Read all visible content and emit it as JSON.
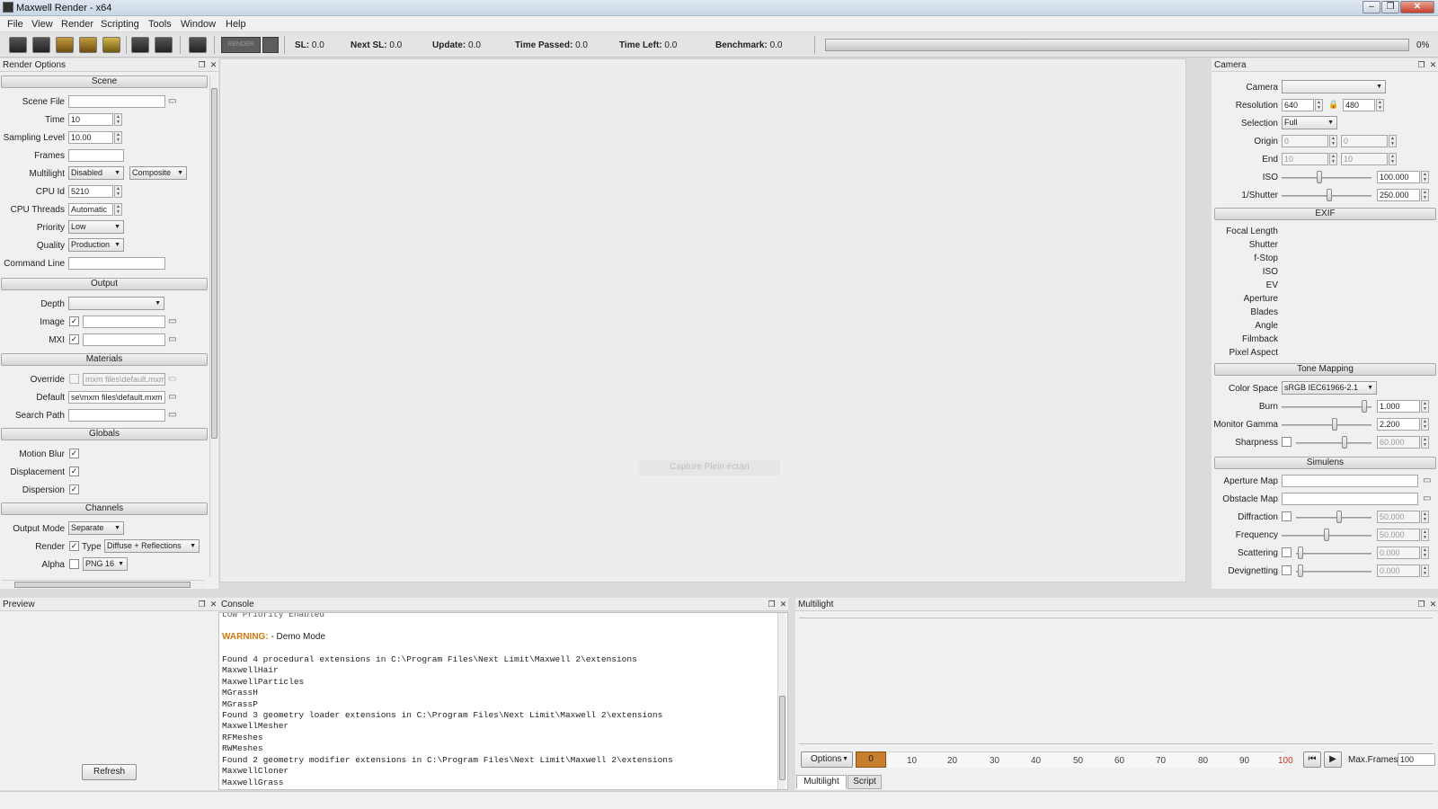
{
  "window": {
    "title": "Maxwell Render -  x64"
  },
  "menu": [
    "File",
    "View",
    "Render",
    "Scripting",
    "Tools",
    "Window",
    "Help"
  ],
  "toolbar": {
    "render_label": "RENDER"
  },
  "status": {
    "sl_label": "SL:",
    "sl_value": "0.0",
    "next_sl_label": "Next SL:",
    "next_sl_value": "0.0",
    "update_label": "Update:",
    "update_value": "0.0",
    "time_passed_label": "Time Passed:",
    "time_passed_value": "0.0",
    "time_left_label": "Time Left:",
    "time_left_value": "0.0",
    "benchmark_label": "Benchmark:",
    "benchmark_value": "0.0",
    "progress_pct": "0%",
    "progress_fraction": 0
  },
  "render_options": {
    "title": "Render Options",
    "sections": {
      "scene": "Scene",
      "output": "Output",
      "materials": "Materials",
      "globals": "Globals",
      "channels": "Channels"
    },
    "scene_file": {
      "label": "Scene File",
      "value": ""
    },
    "time": {
      "label": "Time",
      "value": "10"
    },
    "sampling": {
      "label": "Sampling Level",
      "value": "10.00"
    },
    "frames": {
      "label": "Frames",
      "value": ""
    },
    "multilight": {
      "label": "Multilight",
      "value": "Disabled",
      "mode": "Composite"
    },
    "cpu_id": {
      "label": "CPU Id",
      "value": "5210"
    },
    "cpu_threads": {
      "label": "CPU Threads",
      "value": "Automatic"
    },
    "priority": {
      "label": "Priority",
      "value": "Low"
    },
    "quality": {
      "label": "Quality",
      "value": "Production"
    },
    "command_line": {
      "label": "Command Line",
      "value": ""
    },
    "depth": {
      "label": "Depth",
      "value": ""
    },
    "image": {
      "label": "Image",
      "value": ""
    },
    "mxi": {
      "label": "MXI",
      "value": ""
    },
    "override": {
      "label": "Override",
      "value": "mxm files\\default.mxm"
    },
    "default": {
      "label": "Default",
      "value": "se\\mxm files\\default.mxm"
    },
    "search_path": {
      "label": "Search Path",
      "value": ""
    },
    "motion_blur": "Motion Blur",
    "displacement": "Displacement",
    "dispersion": "Dispersion",
    "output_mode": {
      "label": "Output Mode",
      "value": "Separate"
    },
    "render": {
      "label": "Render",
      "type_label": "Type",
      "type_value": "Diffuse + Reflections"
    },
    "alpha": {
      "label": "Alpha",
      "value": "PNG 16"
    }
  },
  "preview": {
    "title": "Preview",
    "refresh": "Refresh"
  },
  "viewport": {
    "ghost": "Capture Plein écran"
  },
  "console": {
    "title": "Console",
    "lines": [
      "Low Priority Enabled",
      "",
      "Found 4 procedural extensions in C:\\Program Files\\Next Limit\\Maxwell 2\\extensions",
      "MaxwellHair",
      "MaxwellParticles",
      "MGrassH",
      "MGrassP",
      "Found 3 geometry loader extensions in C:\\Program Files\\Next Limit\\Maxwell 2\\extensions",
      "MaxwellMesher",
      "RFMeshes",
      "RWMeshes",
      "Found 2 geometry modifier extensions in C:\\Program Files\\Next Limit\\Maxwell 2\\extensions",
      "MaxwellCloner",
      "MaxwellGrass"
    ],
    "warning_label": "WARNING:",
    "warning_text": " - Demo Mode"
  },
  "camera": {
    "title": "Camera",
    "camera": {
      "label": "Camera",
      "value": ""
    },
    "resolution": {
      "label": "Resolution",
      "w": "640",
      "h": "480"
    },
    "selection": {
      "label": "Selection",
      "value": "Full"
    },
    "origin": {
      "label": "Origin",
      "x": "0",
      "y": "0"
    },
    "end": {
      "label": "End",
      "x": "10",
      "y": "10"
    },
    "iso": {
      "label": "ISO",
      "value": "100.000",
      "slider": 0.42
    },
    "shutter": {
      "label": "1/Shutter",
      "value": "250.000",
      "slider": 0.53
    },
    "exif": {
      "title": "EXIF",
      "fields": [
        "Focal Length",
        "Shutter",
        "f-Stop",
        "ISO",
        "EV",
        "Aperture",
        "Blades",
        "Angle",
        "Filmback",
        "Pixel Aspect"
      ]
    },
    "tone": {
      "title": "Tone Mapping",
      "color_space_label": "Color Space",
      "color_space": "sRGB IEC61966-2.1",
      "burn": {
        "label": "Burn",
        "value": "1.000",
        "slider": 0.95
      },
      "gamma": {
        "label": "Monitor Gamma",
        "value": "2.200",
        "slider": 0.6
      },
      "sharpness": {
        "label": "Sharpness",
        "value": "60.000",
        "slider": 0.65
      }
    },
    "simulens": {
      "title": "Simulens",
      "aperture_map": "Aperture Map",
      "obstacle_map": "Obstacle Map",
      "diffraction": {
        "label": "Diffraction",
        "value": "50.000",
        "slider": 0.58
      },
      "frequency": {
        "label": "Frequency",
        "value": "50.000",
        "slider": 0.5
      },
      "scattering": {
        "label": "Scattering",
        "value": "0.000",
        "slider": 0.02
      },
      "devignetting": {
        "label": "Devignetting",
        "value": "0.000",
        "slider": 0.02
      }
    }
  },
  "multilight": {
    "title": "Multilight",
    "options": "Options",
    "current": "0",
    "ticks": [
      "10",
      "20",
      "30",
      "40",
      "50",
      "60",
      "70",
      "80",
      "90",
      "100"
    ],
    "max_frames_label": "Max.Frames",
    "max_frames": "100",
    "tabs": [
      "Multilight",
      "Script"
    ]
  }
}
